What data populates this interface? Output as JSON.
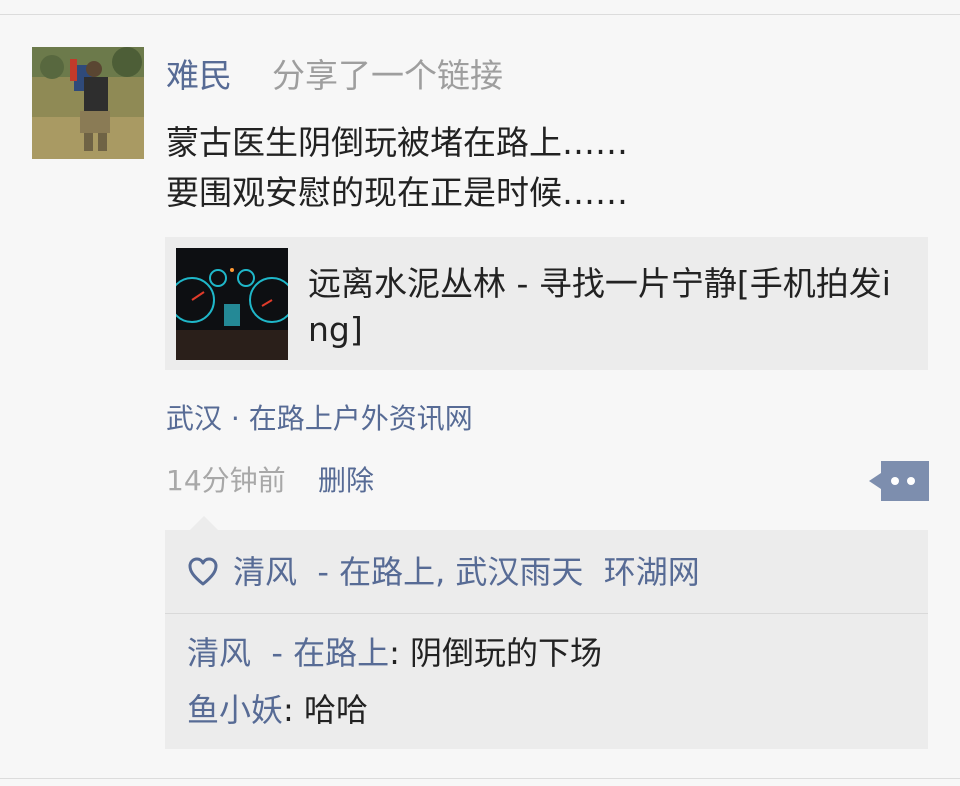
{
  "post": {
    "user_name": "难民",
    "action": "分享了一个链接",
    "text_lines": [
      "蒙古医生阴倒玩被堵在路上……",
      "要围观安慰的现在正是时候……"
    ],
    "link": {
      "title": "远离水泥丛林 - 寻找一片宁静[手机拍发ing]"
    },
    "location": "武汉 · 在路上户外资讯网",
    "time": "14分钟前",
    "delete_label": "删除"
  },
  "likes": {
    "names": "清风  - 在路上, 武汉雨天  环湖网"
  },
  "comments": [
    {
      "author": "清风  - 在路上",
      "separator": ": ",
      "text": "阴倒玩的下场"
    },
    {
      "author": "鱼小妖",
      "separator": ": ",
      "text": "哈哈"
    }
  ],
  "colors": {
    "accent": "#576b95",
    "background": "#f7f7f7",
    "card": "#ececec",
    "muted": "#a8a8a8"
  },
  "icons": {
    "like": "heart-outline-icon",
    "comment": "comment-dots-icon"
  }
}
